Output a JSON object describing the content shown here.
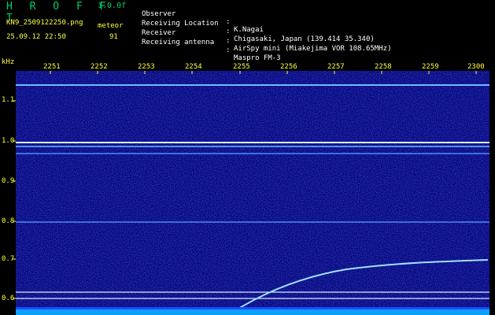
{
  "header": {
    "logo": "H R O F F T",
    "version": "1.0.0f",
    "filename": "KN9_2509122250.png",
    "meteor_label": "meteor",
    "datetime": "25.09.12 22:50",
    "meteor_count": "91"
  },
  "info": [
    {
      "key": "Observer",
      "value": "K.Nagai"
    },
    {
      "key": "Receiving Location",
      "value": "Chigasaki, Japan (139.414 35.340)"
    },
    {
      "key": "Receiver",
      "value": "AirSpy mini (Miakejima VOR 108.65MHz)"
    },
    {
      "key": "Receiving antenna",
      "value": "Maspro FM-3"
    }
  ],
  "y_axis": {
    "unit": "kHz",
    "ticks": [
      "1.1",
      "1.0",
      "0.9",
      "0.8",
      "0.7",
      "0.6"
    ]
  },
  "x_axis": {
    "ticks": [
      "2251",
      "2252",
      "2253",
      "2254",
      "2255",
      "2256",
      "2257",
      "2258",
      "2259",
      "2300"
    ]
  },
  "colors": {
    "background": "#000000",
    "plot_noise": "#0a0a8c",
    "label": "#ffff40",
    "logo": "#00cc66",
    "trace": "#a0e0ff"
  }
}
